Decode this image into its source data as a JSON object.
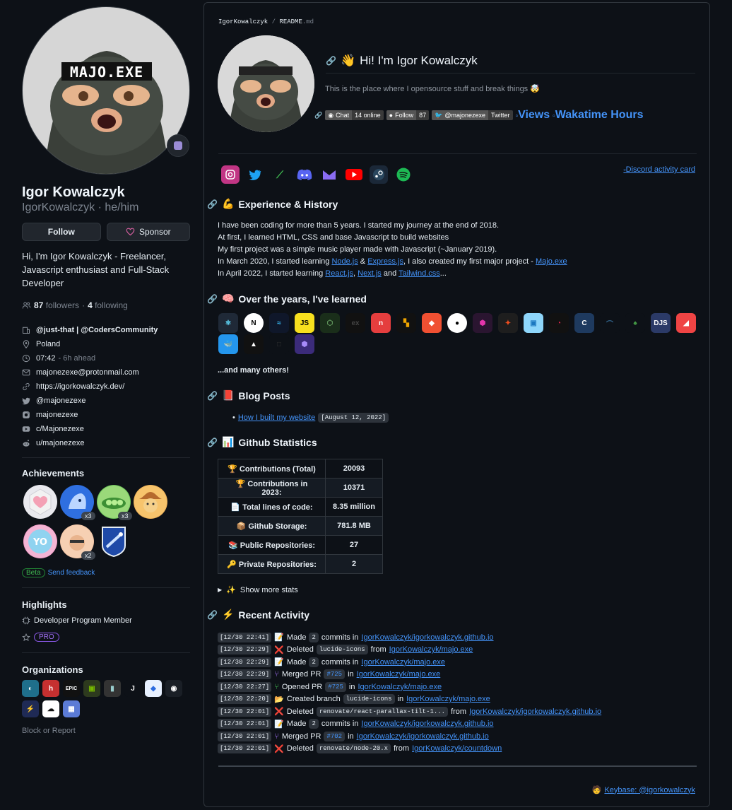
{
  "profile": {
    "name": "Igor Kowalczyk",
    "login": "IgorKowalczyk · he/him",
    "follow_label": "Follow",
    "sponsor_label": "Sponsor",
    "bio": "Hi, I'm Igor Kowalczyk - Freelancer, Javascript enthusiast and Full-Stack Developer",
    "followers_count": "87",
    "followers_label": "followers",
    "following_count": "4",
    "following_label": "following",
    "separator": "·",
    "avatar_text": "MAJO.EXE",
    "company": "@just-that | @CodersCommunity",
    "location": "Poland",
    "time": "07:42",
    "time_note": "- 6h ahead",
    "email": "majonezexe@protonmail.com",
    "website": "https://igorkowalczyk.dev/",
    "twitter": "@majonezexe",
    "instagram": "majonezexe",
    "youtube": "c/Majonezexe",
    "reddit": "u/majonezexe"
  },
  "achievements": {
    "title": "Achievements",
    "counts": [
      "x3",
      "x3",
      "x2"
    ],
    "beta_label": "Beta",
    "feedback_label": "Send feedback"
  },
  "highlights": {
    "title": "Highlights",
    "program": "Developer Program Member",
    "pro": "PRO"
  },
  "organizations": {
    "title": "Organizations",
    "block_report": "Block or Report"
  },
  "readme": {
    "crumb_user": "IgorKowalczyk",
    "crumb_sep": "/",
    "crumb_file": "README",
    "crumb_ext": ".md",
    "greeting": "Hi! I'm Igor Kowalczyk",
    "tagline": "This is the place where I opensource stuff and break things 🤯",
    "shields": {
      "chat_label": "Chat",
      "chat_value": "14 online",
      "follow_label": "Follow",
      "follow_value": "87",
      "twitter_label": "@majonezexe",
      "twitter_value": "Twitter",
      "views": "Views",
      "wakatime": "Wakatime Hours"
    },
    "discord_card": "Discord activity card",
    "experience_title": "Experience & History",
    "experience": {
      "l1": "I have been coding for more than 5 years. I started my journey at the end of 2018.",
      "l2": "At first, I learned HTML, CSS and base Javascript to build websites",
      "l3": "My first project was a simple music player made with Javascript (~January 2019).",
      "l4a": "In March 2020, I started learning",
      "l4b": "Node.js",
      "l4c": "&",
      "l4d": "Express.js",
      "l4e": ", I also created my first major project -",
      "l4f": "Majo.exe",
      "l5a": "In April 2022, I started learning",
      "l5b": "React.js",
      "l5c": ",",
      "l5d": "Next.js",
      "l5e": "and",
      "l5f": "Tailwind.css",
      "l5g": "..."
    },
    "learned_title": "Over the years, I've learned",
    "many_others": "...and many others!",
    "blog_title": "Blog Posts",
    "blog_post": "How I built my website",
    "blog_date": "[August 12, 2022]",
    "stats_title": "Github Statistics",
    "stats": [
      {
        "label": "Contributions (Total)",
        "value": "20093",
        "icon": "🏆"
      },
      {
        "label": "Contributions in 2023:",
        "value": "10371",
        "icon": "🏆"
      },
      {
        "label": "Total lines of code:",
        "value": "8.35 million",
        "icon": "📄"
      },
      {
        "label": "Github Storage:",
        "value": "781.8 MB",
        "icon": "📦"
      },
      {
        "label": "Public Repositories:",
        "value": "27",
        "icon": "📚"
      },
      {
        "label": "Private Repositories:",
        "value": "2",
        "icon": "🔑"
      }
    ],
    "show_more": "Show more stats",
    "activity_title": "Recent Activity",
    "activity": [
      {
        "ts": "[12/30 22:41]",
        "icon": "📝",
        "verb": "Made",
        "code": "2",
        "mid": "commits in",
        "repo": "IgorKowalczyk/igorkowalczyk.github.io",
        "color": "#d29922"
      },
      {
        "ts": "[12/30 22:29]",
        "icon": "❌",
        "verb": "Deleted",
        "code": "lucide-icons",
        "mid": "from",
        "repo": "IgorKowalczyk/majo.exe",
        "color": "#f85149"
      },
      {
        "ts": "[12/30 22:29]",
        "icon": "📝",
        "verb": "Made",
        "code": "2",
        "mid": "commits in",
        "repo": "IgorKowalczyk/majo.exe",
        "color": "#d29922"
      },
      {
        "ts": "[12/30 22:29]",
        "icon": "⑂",
        "verb": "Merged PR",
        "code": "#725",
        "mid": "in",
        "repo": "IgorKowalczyk/majo.exe",
        "color": "#a371f7"
      },
      {
        "ts": "[12/30 22:27]",
        "icon": "⑂",
        "verb": "Opened PR",
        "code": "#725",
        "mid": "in",
        "repo": "IgorKowalczyk/majo.exe",
        "color": "#3fb950"
      },
      {
        "ts": "[12/30 22:20]",
        "icon": "📂",
        "verb": "Created branch",
        "code": "lucide-icons",
        "mid": "in",
        "repo": "IgorKowalczyk/majo.exe",
        "color": "#3fb950"
      },
      {
        "ts": "[12/30 22:01]",
        "icon": "❌",
        "verb": "Deleted",
        "code": "renovate/react-parallax-tilt-1...",
        "mid": "from",
        "repo": "IgorKowalczyk/igorkowalczyk.github.io",
        "color": "#f85149"
      },
      {
        "ts": "[12/30 22:01]",
        "icon": "📝",
        "verb": "Made",
        "code": "2",
        "mid": "commits in",
        "repo": "IgorKowalczyk/igorkowalczyk.github.io",
        "color": "#d29922"
      },
      {
        "ts": "[12/30 22:01]",
        "icon": "⑂",
        "verb": "Merged PR",
        "code": "#702",
        "mid": "in",
        "repo": "IgorKowalczyk/igorkowalczyk.github.io",
        "color": "#a371f7"
      },
      {
        "ts": "[12/30 22:01]",
        "icon": "❌",
        "verb": "Deleted",
        "code": "renovate/node-20.x",
        "mid": "from",
        "repo": "IgorKowalczyk/countdown",
        "color": "#f85149"
      }
    ],
    "keybase": "Keybase: @igorkowalczyk"
  },
  "colors": {
    "bg": "#0d1117",
    "border": "#30363d",
    "link": "#4493f8",
    "muted": "#7d8590",
    "sponsor_heart": "#db61a2"
  }
}
